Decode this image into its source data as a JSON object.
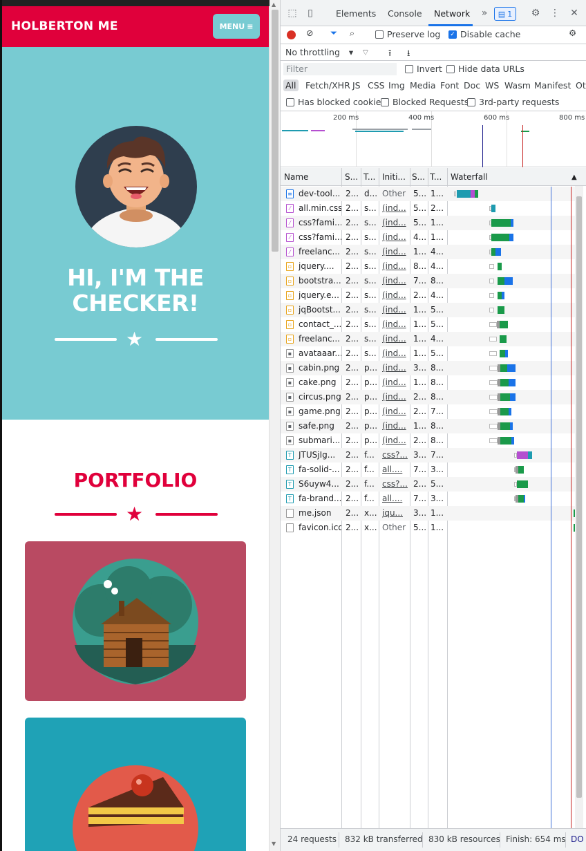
{
  "page": {
    "brand": "HOLBERTON ME",
    "menu_label": "MENU",
    "hero_title_line1": "HI, I'M THE",
    "hero_title_line2": "CHECKER!",
    "portfolio_title": "PORTFOLIO",
    "colors": {
      "primary": "#e0003b",
      "teal": "#78cbd2",
      "card1": "#b94a62",
      "card2": "#1fa2b6"
    }
  },
  "devtools": {
    "tabs": [
      "Elements",
      "Console",
      "Network"
    ],
    "active_tab": "Network",
    "issues_count": "1",
    "toolbar": {
      "preserve_log": "Preserve log",
      "disable_cache": "Disable cache",
      "throttling": "No throttling"
    },
    "filter": {
      "placeholder": "Filter",
      "invert": "Invert",
      "hide_data_urls": "Hide data URLs"
    },
    "types": [
      "All",
      "Fetch/XHR",
      "JS",
      "CSS",
      "Img",
      "Media",
      "Font",
      "Doc",
      "WS",
      "Wasm",
      "Manifest",
      "Oth"
    ],
    "blocked": {
      "has_blocked_cookies": "Has blocked cookies",
      "blocked_requests": "Blocked Requests",
      "third_party": "3rd-party requests"
    },
    "overview_ticks": [
      "200 ms",
      "400 ms",
      "600 ms",
      "800 ms"
    ],
    "columns": [
      "Name",
      "S...",
      "T...",
      "Initi...",
      "S...",
      "T...",
      "Waterfall"
    ],
    "requests": [
      {
        "name": "dev-tool...",
        "status": "2...",
        "type": "d...",
        "initiator": "Other",
        "size": "5...",
        "time": "1...",
        "icon": "doc"
      },
      {
        "name": "all.min.css",
        "status": "2...",
        "type": "s...",
        "initiator": "(ind...",
        "size": "5...",
        "time": "2...",
        "icon": "css"
      },
      {
        "name": "css?fami...",
        "status": "2...",
        "type": "s...",
        "initiator": "(ind...",
        "size": "5...",
        "time": "1...",
        "icon": "css"
      },
      {
        "name": "css?fami...",
        "status": "2...",
        "type": "s...",
        "initiator": "(ind...",
        "size": "4...",
        "time": "1...",
        "icon": "css"
      },
      {
        "name": "freelanc...",
        "status": "2...",
        "type": "s...",
        "initiator": "(ind...",
        "size": "1...",
        "time": "4...",
        "icon": "css"
      },
      {
        "name": "jquery....",
        "status": "2...",
        "type": "s...",
        "initiator": "(ind...",
        "size": "8...",
        "time": "4...",
        "icon": "js"
      },
      {
        "name": "bootstra...",
        "status": "2...",
        "type": "s...",
        "initiator": "(ind...",
        "size": "7...",
        "time": "8...",
        "icon": "js"
      },
      {
        "name": "jquery.e...",
        "status": "2...",
        "type": "s...",
        "initiator": "(ind...",
        "size": "2...",
        "time": "4...",
        "icon": "js"
      },
      {
        "name": "jqBootst...",
        "status": "2...",
        "type": "s...",
        "initiator": "(ind...",
        "size": "1...",
        "time": "5...",
        "icon": "js"
      },
      {
        "name": "contact_...",
        "status": "2...",
        "type": "s...",
        "initiator": "(ind...",
        "size": "1...",
        "time": "5...",
        "icon": "js"
      },
      {
        "name": "freelanc...",
        "status": "2...",
        "type": "s...",
        "initiator": "(ind...",
        "size": "1...",
        "time": "4...",
        "icon": "js"
      },
      {
        "name": "avataaar...",
        "status": "2...",
        "type": "s...",
        "initiator": "(ind...",
        "size": "1...",
        "time": "5...",
        "icon": "img"
      },
      {
        "name": "cabin.png",
        "status": "2...",
        "type": "p...",
        "initiator": "(ind...",
        "size": "3...",
        "time": "8...",
        "icon": "img"
      },
      {
        "name": "cake.png",
        "status": "2...",
        "type": "p...",
        "initiator": "(ind...",
        "size": "1...",
        "time": "8...",
        "icon": "img"
      },
      {
        "name": "circus.png",
        "status": "2...",
        "type": "p...",
        "initiator": "(ind...",
        "size": "2...",
        "time": "8...",
        "icon": "img"
      },
      {
        "name": "game.png",
        "status": "2...",
        "type": "p...",
        "initiator": "(ind...",
        "size": "2...",
        "time": "7...",
        "icon": "img"
      },
      {
        "name": "safe.png",
        "status": "2...",
        "type": "p...",
        "initiator": "(ind...",
        "size": "1...",
        "time": "8...",
        "icon": "img"
      },
      {
        "name": "submari...",
        "status": "2...",
        "type": "p...",
        "initiator": "(ind...",
        "size": "2...",
        "time": "8...",
        "icon": "img"
      },
      {
        "name": "JTUSjIg...",
        "status": "2...",
        "type": "f...",
        "initiator": "css?...",
        "size": "3...",
        "time": "7...",
        "icon": "font"
      },
      {
        "name": "fa-solid-...",
        "status": "2...",
        "type": "f...",
        "initiator": "all....",
        "size": "7...",
        "time": "3...",
        "icon": "font"
      },
      {
        "name": "S6uyw4...",
        "status": "2...",
        "type": "f...",
        "initiator": "css?...",
        "size": "2...",
        "time": "5...",
        "icon": "font"
      },
      {
        "name": "fa-brand...",
        "status": "2...",
        "type": "f...",
        "initiator": "all....",
        "size": "7...",
        "time": "3...",
        "icon": "font"
      },
      {
        "name": "me.json",
        "status": "2...",
        "type": "x...",
        "initiator": "jqu...",
        "size": "3...",
        "time": "1...",
        "icon": "fetch"
      },
      {
        "name": "favicon.ico",
        "status": "2...",
        "type": "x...",
        "initiator": "Other",
        "size": "5...",
        "time": "1...",
        "icon": "fetch"
      }
    ],
    "status_bar": {
      "requests": "24 requests",
      "transferred": "832 kB transferred",
      "resources": "830 kB resources",
      "finish": "Finish: 654 ms",
      "dom": "DO"
    }
  }
}
